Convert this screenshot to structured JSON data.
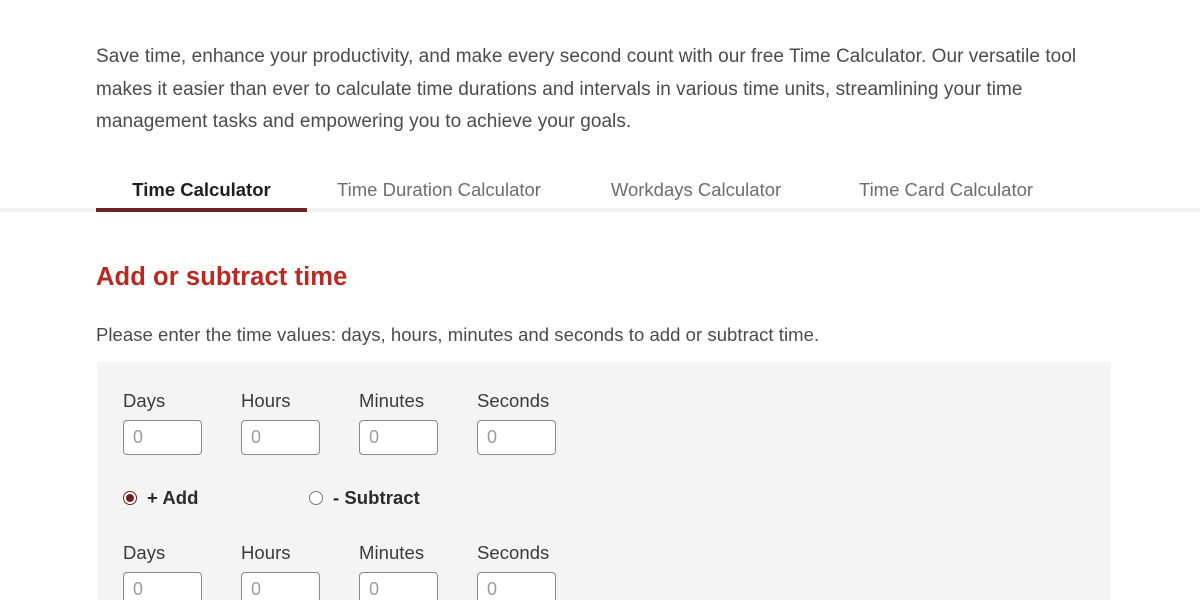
{
  "intro": {
    "paragraph": "Save time, enhance your productivity, and make every second count with our free Time Calculator. Our versatile tool makes it easier than ever to calculate time durations and intervals in various time units, streamlining your time management tasks and empowering you to achieve your goals."
  },
  "tabs": {
    "items": [
      {
        "label": "Time Calculator",
        "active": true
      },
      {
        "label": "Time Duration Calculator",
        "active": false
      },
      {
        "label": "Workdays Calculator",
        "active": false
      },
      {
        "label": "Time Card Calculator",
        "active": false
      }
    ],
    "active_index": 0
  },
  "section": {
    "heading": "Add or subtract time",
    "instruction": "Please enter the time values: days, hours, minutes and seconds to add or subtract time."
  },
  "form": {
    "row1": {
      "fields": [
        {
          "label": "Days",
          "value": "",
          "placeholder": "0"
        },
        {
          "label": "Hours",
          "value": "",
          "placeholder": "0"
        },
        {
          "label": "Minutes",
          "value": "",
          "placeholder": "0"
        },
        {
          "label": "Seconds",
          "value": "",
          "placeholder": "0"
        }
      ]
    },
    "operation": {
      "options": [
        {
          "label": "+ Add",
          "selected": true
        },
        {
          "label": "- Subtract",
          "selected": false
        }
      ],
      "selected_label": "+ Add"
    },
    "row2": {
      "fields": [
        {
          "label": "Days",
          "value": "",
          "placeholder": "0"
        },
        {
          "label": "Hours",
          "value": "",
          "placeholder": "0"
        },
        {
          "label": "Minutes",
          "value": "",
          "placeholder": "0"
        },
        {
          "label": "Seconds",
          "value": "",
          "placeholder": "0"
        }
      ]
    }
  },
  "colors": {
    "heading_red": "#b92b22",
    "tab_accent": "#6b2222",
    "panel_bg": "#f4f4f4",
    "body_text": "#4b4b4b",
    "page_bg": "#ffffff"
  }
}
